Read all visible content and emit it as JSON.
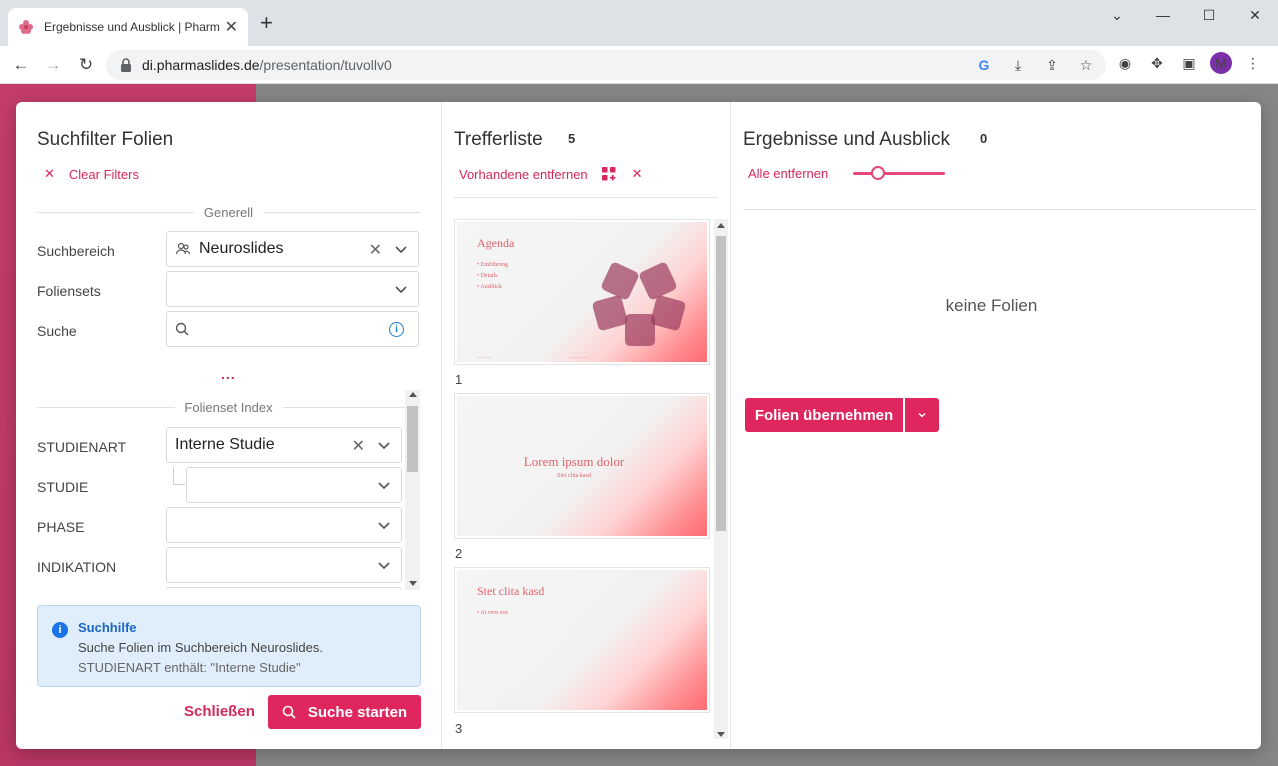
{
  "browser": {
    "tab_title": "Ergebnisse und Ausblick | Pharm",
    "url_domain": "di.pharmaslides.de",
    "url_path": "/presentation/tuvollv0",
    "avatar_initial": "M"
  },
  "filter_panel": {
    "title": "Suchfilter Folien",
    "clear_filters": "Clear Filters",
    "section_general": "Generell",
    "search_area_label": "Suchbereich",
    "search_area_value": "Neuroslides",
    "slidesets_label": "Foliensets",
    "search_label": "Suche",
    "search_value": "",
    "more": "...",
    "section_index": "Folienset Index",
    "index_fields": [
      {
        "label": "STUDIENART",
        "value": "Interne Studie"
      },
      {
        "label": "STUDIE",
        "value": ""
      },
      {
        "label": "PHASE",
        "value": ""
      },
      {
        "label": "INDIKATION",
        "value": ""
      }
    ],
    "help": {
      "title": "Suchhilfe",
      "line1": "Suche Folien im Suchbereich Neuroslides.",
      "line2": "STUDIENART enthält: \"Interne Studie\""
    },
    "close_button": "Schließen",
    "search_button": "Suche starten"
  },
  "results": {
    "title": "Trefferliste",
    "count": "5",
    "remove_existing": "Vorhandene entfernen",
    "slides": [
      {
        "number": "1",
        "title": "Agenda",
        "bullets": [
          "• Einführung",
          "• Details",
          "• Ausblick"
        ]
      },
      {
        "number": "2",
        "title": "Lorem ipsum dolor",
        "subtitle": "Stet clita kasd"
      },
      {
        "number": "3",
        "title": "Stet clita kasd",
        "bullets": [
          "• At vero eos"
        ]
      }
    ]
  },
  "outcome": {
    "title": "Ergebnisse und Ausblick",
    "count": "0",
    "remove_all": "Alle entfernen",
    "empty_text": "keine Folien",
    "take_button": "Folien übernehmen"
  },
  "colors": {
    "accent": "#e0265e",
    "brand_left": "#c43d6a",
    "info": "#1a73e8"
  }
}
